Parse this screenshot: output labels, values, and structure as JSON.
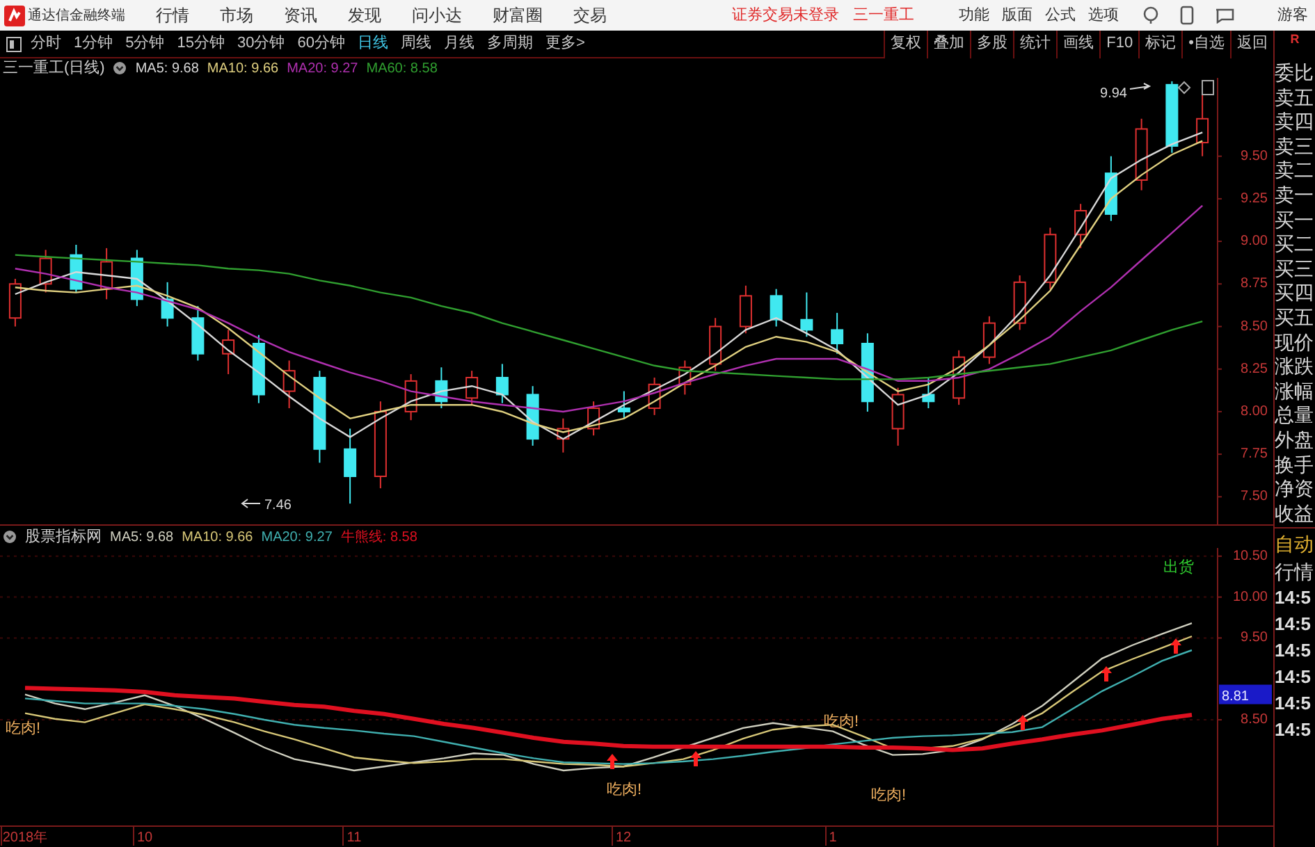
{
  "top_bar": {
    "app_title": "通达信金融终端",
    "menu": [
      "行情",
      "市场",
      "资讯",
      "发现",
      "问小达",
      "财富圈",
      "交易"
    ],
    "status": "证券交易未登录",
    "stock": "三一重工",
    "tools": [
      "功能",
      "版面",
      "公式",
      "选项"
    ],
    "user": "游客"
  },
  "period_tabs": [
    {
      "label": "分时",
      "selected": false
    },
    {
      "label": "1分钟",
      "selected": false
    },
    {
      "label": "5分钟",
      "selected": false
    },
    {
      "label": "15分钟",
      "selected": false
    },
    {
      "label": "30分钟",
      "selected": false
    },
    {
      "label": "60分钟",
      "selected": false
    },
    {
      "label": "日线",
      "selected": true
    },
    {
      "label": "周线",
      "selected": false
    },
    {
      "label": "月线",
      "selected": false
    },
    {
      "label": "多周期",
      "selected": false
    },
    {
      "label": "更多>",
      "selected": false
    }
  ],
  "tool_buttons": [
    "复权",
    "叠加",
    "多股",
    "统计",
    "画线",
    "F10",
    "标记",
    "•自选",
    "返回"
  ],
  "main_chart": {
    "title": "三一重工(日线)",
    "legend_values": [
      ": 9.68",
      ": 9.66",
      ": 9.27",
      ": 8.58"
    ],
    "chart_data": {
      "type": "candlestick",
      "categories": [
        null,
        null,
        null,
        null,
        null,
        null,
        null,
        null,
        null,
        null,
        null,
        null,
        null,
        null,
        null,
        null,
        null,
        null,
        null,
        null,
        null,
        null,
        null,
        null,
        null,
        null,
        null,
        null,
        null,
        null,
        null,
        null,
        null,
        null,
        null,
        null,
        null,
        null,
        null,
        null
      ],
      "ylim": [
        7.33,
        9.96
      ],
      "yticks": [
        {
          "value": 7.5,
          "label": "7.50"
        },
        {
          "value": 7.75,
          "label": "7.75"
        },
        {
          "value": 8.0,
          "label": "8.00"
        },
        {
          "value": 8.25,
          "label": "8.25"
        },
        {
          "value": 8.5,
          "label": "8.50"
        },
        {
          "value": 8.75,
          "label": "8.75"
        },
        {
          "value": 9.0,
          "label": "9.00"
        },
        {
          "value": 9.25,
          "label": "9.25"
        },
        {
          "value": 9.5,
          "label": "9.50"
        }
      ],
      "ohlc": [
        [
          8.55,
          8.78,
          8.5,
          8.75
        ],
        [
          8.75,
          8.95,
          8.7,
          8.9
        ],
        [
          8.92,
          8.98,
          8.7,
          8.72
        ],
        [
          8.72,
          8.96,
          8.66,
          8.88
        ],
        [
          8.9,
          8.95,
          8.62,
          8.66
        ],
        [
          8.66,
          8.76,
          8.5,
          8.55
        ],
        [
          8.55,
          8.62,
          8.3,
          8.34
        ],
        [
          8.34,
          8.48,
          8.22,
          8.42
        ],
        [
          8.4,
          8.45,
          8.05,
          8.1
        ],
        [
          8.12,
          8.3,
          8.02,
          8.24
        ],
        [
          8.2,
          8.24,
          7.7,
          7.78
        ],
        [
          7.78,
          7.9,
          7.46,
          7.62
        ],
        [
          7.62,
          8.06,
          7.55,
          8.0
        ],
        [
          8.0,
          8.22,
          7.95,
          8.18
        ],
        [
          8.18,
          8.26,
          8.02,
          8.06
        ],
        [
          8.08,
          8.24,
          8.04,
          8.2
        ],
        [
          8.2,
          8.28,
          8.05,
          8.1
        ],
        [
          8.1,
          8.15,
          7.8,
          7.84
        ],
        [
          7.84,
          7.96,
          7.76,
          7.9
        ],
        [
          7.9,
          8.06,
          7.86,
          8.02
        ],
        [
          8.02,
          8.12,
          7.96,
          8.0
        ],
        [
          8.02,
          8.2,
          7.98,
          8.16
        ],
        [
          8.16,
          8.3,
          8.1,
          8.26
        ],
        [
          8.28,
          8.55,
          8.24,
          8.5
        ],
        [
          8.5,
          8.74,
          8.46,
          8.68
        ],
        [
          8.68,
          8.72,
          8.5,
          8.54
        ],
        [
          8.54,
          8.7,
          8.44,
          8.48
        ],
        [
          8.48,
          8.58,
          8.34,
          8.4
        ],
        [
          8.4,
          8.46,
          8.0,
          8.06
        ],
        [
          7.9,
          8.14,
          7.8,
          8.1
        ],
        [
          8.1,
          8.2,
          8.02,
          8.06
        ],
        [
          8.08,
          8.36,
          8.04,
          8.32
        ],
        [
          8.32,
          8.56,
          8.28,
          8.52
        ],
        [
          8.52,
          8.8,
          8.48,
          8.76
        ],
        [
          8.76,
          9.08,
          8.72,
          9.04
        ],
        [
          9.04,
          9.22,
          8.96,
          9.18
        ],
        [
          9.4,
          9.5,
          9.12,
          9.16
        ],
        [
          9.36,
          9.72,
          9.3,
          9.66
        ],
        [
          9.92,
          9.94,
          9.52,
          9.56
        ],
        [
          9.58,
          9.86,
          9.5,
          9.72
        ]
      ],
      "series": [
        {
          "name": "MA5",
          "type": "line",
          "color": "#d8d8d8",
          "values": [
            8.69,
            8.76,
            8.82,
            8.8,
            8.78,
            8.65,
            8.51,
            8.36,
            8.23,
            8.09,
            7.96,
            7.85,
            7.96,
            8.06,
            8.12,
            8.15,
            8.1,
            7.94,
            7.84,
            7.94,
            8.04,
            8.13,
            8.22,
            8.34,
            8.48,
            8.55,
            8.46,
            8.36,
            8.2,
            8.04,
            8.1,
            8.23,
            8.39,
            8.58,
            8.8,
            9.08,
            9.37,
            9.48,
            9.57,
            9.64
          ]
        },
        {
          "name": "MA10",
          "type": "line",
          "color": "#e0d080",
          "values": [
            8.73,
            8.71,
            8.7,
            8.72,
            8.74,
            8.68,
            8.61,
            8.49,
            8.35,
            8.21,
            8.08,
            7.96,
            8.0,
            8.04,
            8.04,
            8.04,
            8.0,
            7.93,
            7.88,
            7.92,
            7.96,
            8.06,
            8.17,
            8.27,
            8.38,
            8.44,
            8.41,
            8.35,
            8.23,
            8.12,
            8.16,
            8.26,
            8.39,
            8.54,
            8.71,
            8.98,
            9.25,
            9.39,
            9.51,
            9.59
          ]
        },
        {
          "name": "MA20",
          "type": "line",
          "color": "#b030b0",
          "values": [
            8.84,
            8.81,
            8.77,
            8.73,
            8.7,
            8.65,
            8.6,
            8.52,
            8.43,
            8.35,
            8.29,
            8.23,
            8.18,
            8.12,
            8.09,
            8.06,
            8.04,
            8.02,
            8.0,
            8.03,
            8.06,
            8.11,
            8.17,
            8.22,
            8.27,
            8.31,
            8.31,
            8.31,
            8.25,
            8.18,
            8.18,
            8.2,
            8.25,
            8.34,
            8.44,
            8.59,
            8.73,
            8.89,
            9.05,
            9.21
          ]
        },
        {
          "name": "MA60",
          "type": "line",
          "color": "#30a030",
          "values": [
            8.92,
            8.91,
            8.9,
            8.89,
            8.88,
            8.87,
            8.86,
            8.84,
            8.83,
            8.81,
            8.77,
            8.74,
            8.7,
            8.67,
            8.62,
            8.58,
            8.52,
            8.47,
            8.42,
            8.37,
            8.32,
            8.27,
            8.24,
            8.23,
            8.22,
            8.21,
            8.2,
            8.19,
            8.19,
            8.19,
            8.2,
            8.22,
            8.24,
            8.26,
            8.28,
            8.32,
            8.36,
            8.42,
            8.48,
            8.53
          ]
        }
      ],
      "annotations": [
        "9.94",
        "7.46"
      ]
    }
  },
  "indicator_chart": {
    "title": "股票指标网",
    "legend_values": [
      ": 9.68",
      ": 9.66",
      ": 9.27",
      ": 8.58"
    ],
    "price_box": "8.81",
    "chart_data": {
      "type": "line",
      "grid": true,
      "categories": [
        "2018年",
        null,
        null,
        null,
        "10",
        null,
        null,
        null,
        null,
        null,
        null,
        "11",
        null,
        null,
        null,
        null,
        null,
        null,
        null,
        null,
        "12",
        null,
        null,
        null,
        null,
        null,
        null,
        "1",
        null,
        null,
        null,
        null,
        null,
        null,
        null,
        null,
        null,
        null,
        null,
        null
      ],
      "ylim": [
        7.2,
        10.6
      ],
      "yticks": [
        {
          "value": 8.5,
          "label": "8.50"
        },
        {
          "value": 9.5,
          "label": "9.50"
        },
        {
          "value": 10.0,
          "label": "10.00"
        },
        {
          "value": 10.5,
          "label": "10.50"
        }
      ],
      "series": [
        {
          "name": "MA5",
          "color": "#d0d0c0",
          "values": [
            8.81,
            8.7,
            8.63,
            8.71,
            8.8,
            8.67,
            8.51,
            8.34,
            8.16,
            8.02,
            7.95,
            7.88,
            7.93,
            7.98,
            8.03,
            8.09,
            8.07,
            7.96,
            7.88,
            7.91,
            7.93,
            8.04,
            8.16,
            8.28,
            8.4,
            8.46,
            8.41,
            8.36,
            8.2,
            8.07,
            8.08,
            8.13,
            8.26,
            8.45,
            8.67,
            8.96,
            9.25,
            9.41,
            9.55,
            9.68
          ]
        },
        {
          "name": "MA10",
          "color": "#d8c878",
          "values": [
            8.58,
            8.51,
            8.47,
            8.58,
            8.69,
            8.63,
            8.56,
            8.47,
            8.36,
            8.26,
            8.15,
            8.04,
            8.0,
            7.97,
            7.99,
            8.02,
            8.02,
            7.99,
            7.96,
            7.95,
            7.93,
            7.97,
            8.02,
            8.13,
            8.27,
            8.38,
            8.42,
            8.44,
            8.3,
            8.15,
            8.15,
            8.18,
            8.27,
            8.41,
            8.58,
            8.84,
            9.09,
            9.24,
            9.38,
            9.52
          ]
        },
        {
          "name": "MA20",
          "color": "#40b0b0",
          "values": [
            8.76,
            8.73,
            8.7,
            8.7,
            8.7,
            8.67,
            8.63,
            8.57,
            8.5,
            8.44,
            8.4,
            8.37,
            8.33,
            8.3,
            8.23,
            8.16,
            8.09,
            8.03,
            7.98,
            7.97,
            7.96,
            7.97,
            7.99,
            8.02,
            8.06,
            8.11,
            8.15,
            8.2,
            8.24,
            8.28,
            8.3,
            8.31,
            8.33,
            8.35,
            8.41,
            8.63,
            8.85,
            9.03,
            9.22,
            9.35
          ]
        },
        {
          "name": "牛熊线",
          "color": "#e01020",
          "values": [
            8.89,
            8.88,
            8.87,
            8.86,
            8.84,
            8.8,
            8.78,
            8.76,
            8.72,
            8.68,
            8.66,
            8.61,
            8.57,
            8.51,
            8.45,
            8.4,
            8.34,
            8.28,
            8.23,
            8.21,
            8.18,
            8.17,
            8.17,
            8.17,
            8.17,
            8.17,
            8.17,
            8.17,
            8.16,
            8.16,
            8.15,
            8.13,
            8.15,
            8.21,
            8.26,
            8.32,
            8.37,
            8.44,
            8.51,
            8.56
          ]
        }
      ],
      "annotations": [
        "出货",
        "吃肉!",
        "吃肉!",
        "吃肉!",
        "吃肉!"
      ]
    }
  },
  "quote_panel": {
    "badge": "R",
    "fields": [
      "委比",
      "卖五",
      "卖四",
      "卖三",
      "卖二",
      "卖一",
      "买一",
      "买二",
      "买三",
      "买四",
      "买五",
      "现价",
      "涨跌",
      "涨幅",
      "总量",
      "外盘",
      "换手",
      "净资",
      "收益"
    ],
    "tabs": [
      "自动",
      "行情"
    ],
    "times": [
      "14:5",
      "14:5",
      "14:5",
      "14:5",
      "14:5",
      "14:5"
    ]
  }
}
